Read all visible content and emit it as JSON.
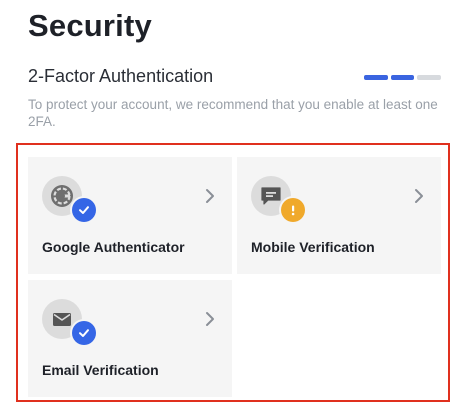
{
  "page": {
    "title": "Security"
  },
  "section": {
    "title": "2-Factor Authentication",
    "description": "To protect your account, we recommend that you enable at least one 2FA.",
    "progress": {
      "completed": 2,
      "total": 3
    }
  },
  "methods": [
    {
      "label": "Google Authenticator",
      "icon": "google-authenticator-icon",
      "status": "enabled",
      "status_icon": "check-badge-icon"
    },
    {
      "label": "Mobile Verification",
      "icon": "message-icon",
      "status": "warning",
      "status_icon": "warning-badge-icon"
    },
    {
      "label": "Email Verification",
      "icon": "envelope-icon",
      "status": "enabled",
      "status_icon": "check-badge-icon"
    }
  ],
  "colors": {
    "accent": "#3566e6",
    "warning": "#f0a92b",
    "highlight_border": "#e0301e",
    "card_bg": "#f5f5f5"
  }
}
